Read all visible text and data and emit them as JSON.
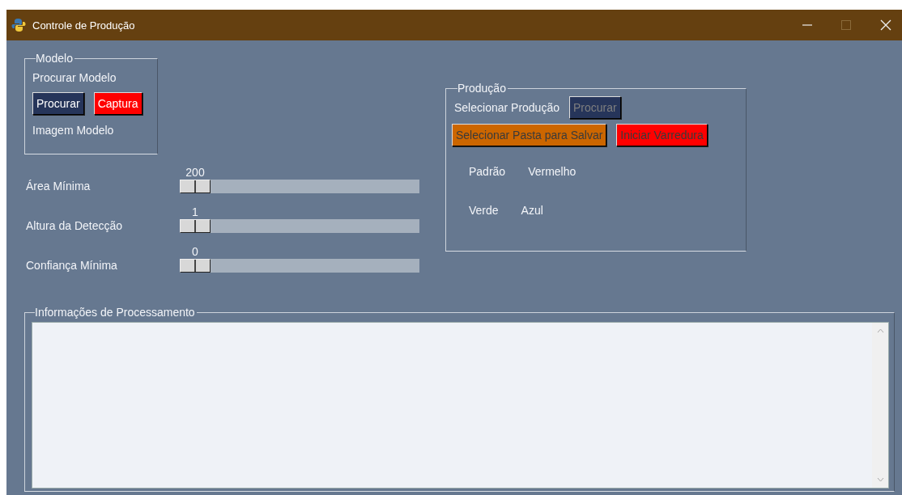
{
  "window": {
    "title": "Controle de Produção",
    "maximize_disabled": true
  },
  "modelo": {
    "legend": "Modelo",
    "label": "Procurar Modelo",
    "buttons": [
      {
        "label": "Procurar",
        "kind": "navy",
        "disabled": false
      },
      {
        "label": "Captura",
        "kind": "red",
        "disabled": false
      }
    ],
    "image_label": "Imagem Modelo"
  },
  "sliders": [
    {
      "label": "Área Mínima",
      "value": "200",
      "level": 0
    },
    {
      "label": "Altura da Detecção",
      "value": "1",
      "level": 0
    },
    {
      "label": "Confiança Mínima",
      "value": "0",
      "level": 0
    }
  ],
  "producao": {
    "legend": "Produção",
    "label": "Selecionar Produção",
    "search_button": {
      "label": "Procurar",
      "kind": "navy",
      "disabled": true
    },
    "buttons": [
      {
        "label": "Selecionar Pasta para Salvar",
        "kind": "orange",
        "disabled": true
      },
      {
        "label": "Iniciar Varredura",
        "kind": "red",
        "disabled": true
      }
    ],
    "colors": [
      [
        "Padrão",
        "Vermelho"
      ],
      [
        "Verde",
        "Azul"
      ]
    ]
  },
  "info": {
    "legend": "Informações de Processamento"
  }
}
